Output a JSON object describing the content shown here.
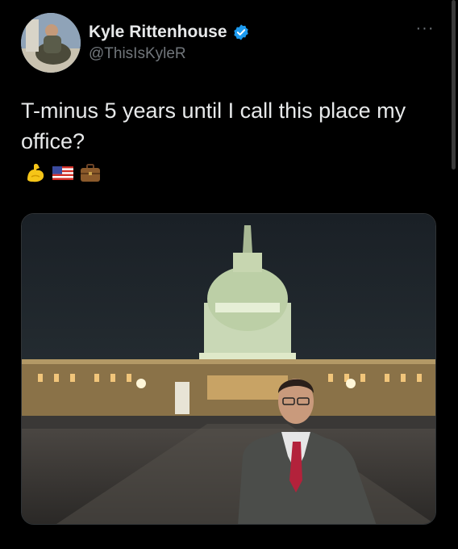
{
  "author": {
    "display_name": "Kyle Rittenhouse",
    "handle": "@ThisIsKyleR",
    "verified": true,
    "avatar_icon": "profile-photo"
  },
  "tweet": {
    "text": "T-minus 5 years until I call this place my office?",
    "emojis": [
      "flexed-biceps-emoji",
      "us-flag-emoji",
      "briefcase-emoji"
    ]
  },
  "media": {
    "description_icon": "capitol-building-photo"
  },
  "menu": {
    "more_label": "···"
  },
  "colors": {
    "background": "#000000",
    "text": "#e7e9ea",
    "secondary": "#71767b",
    "verified": "#1d9bf0"
  }
}
